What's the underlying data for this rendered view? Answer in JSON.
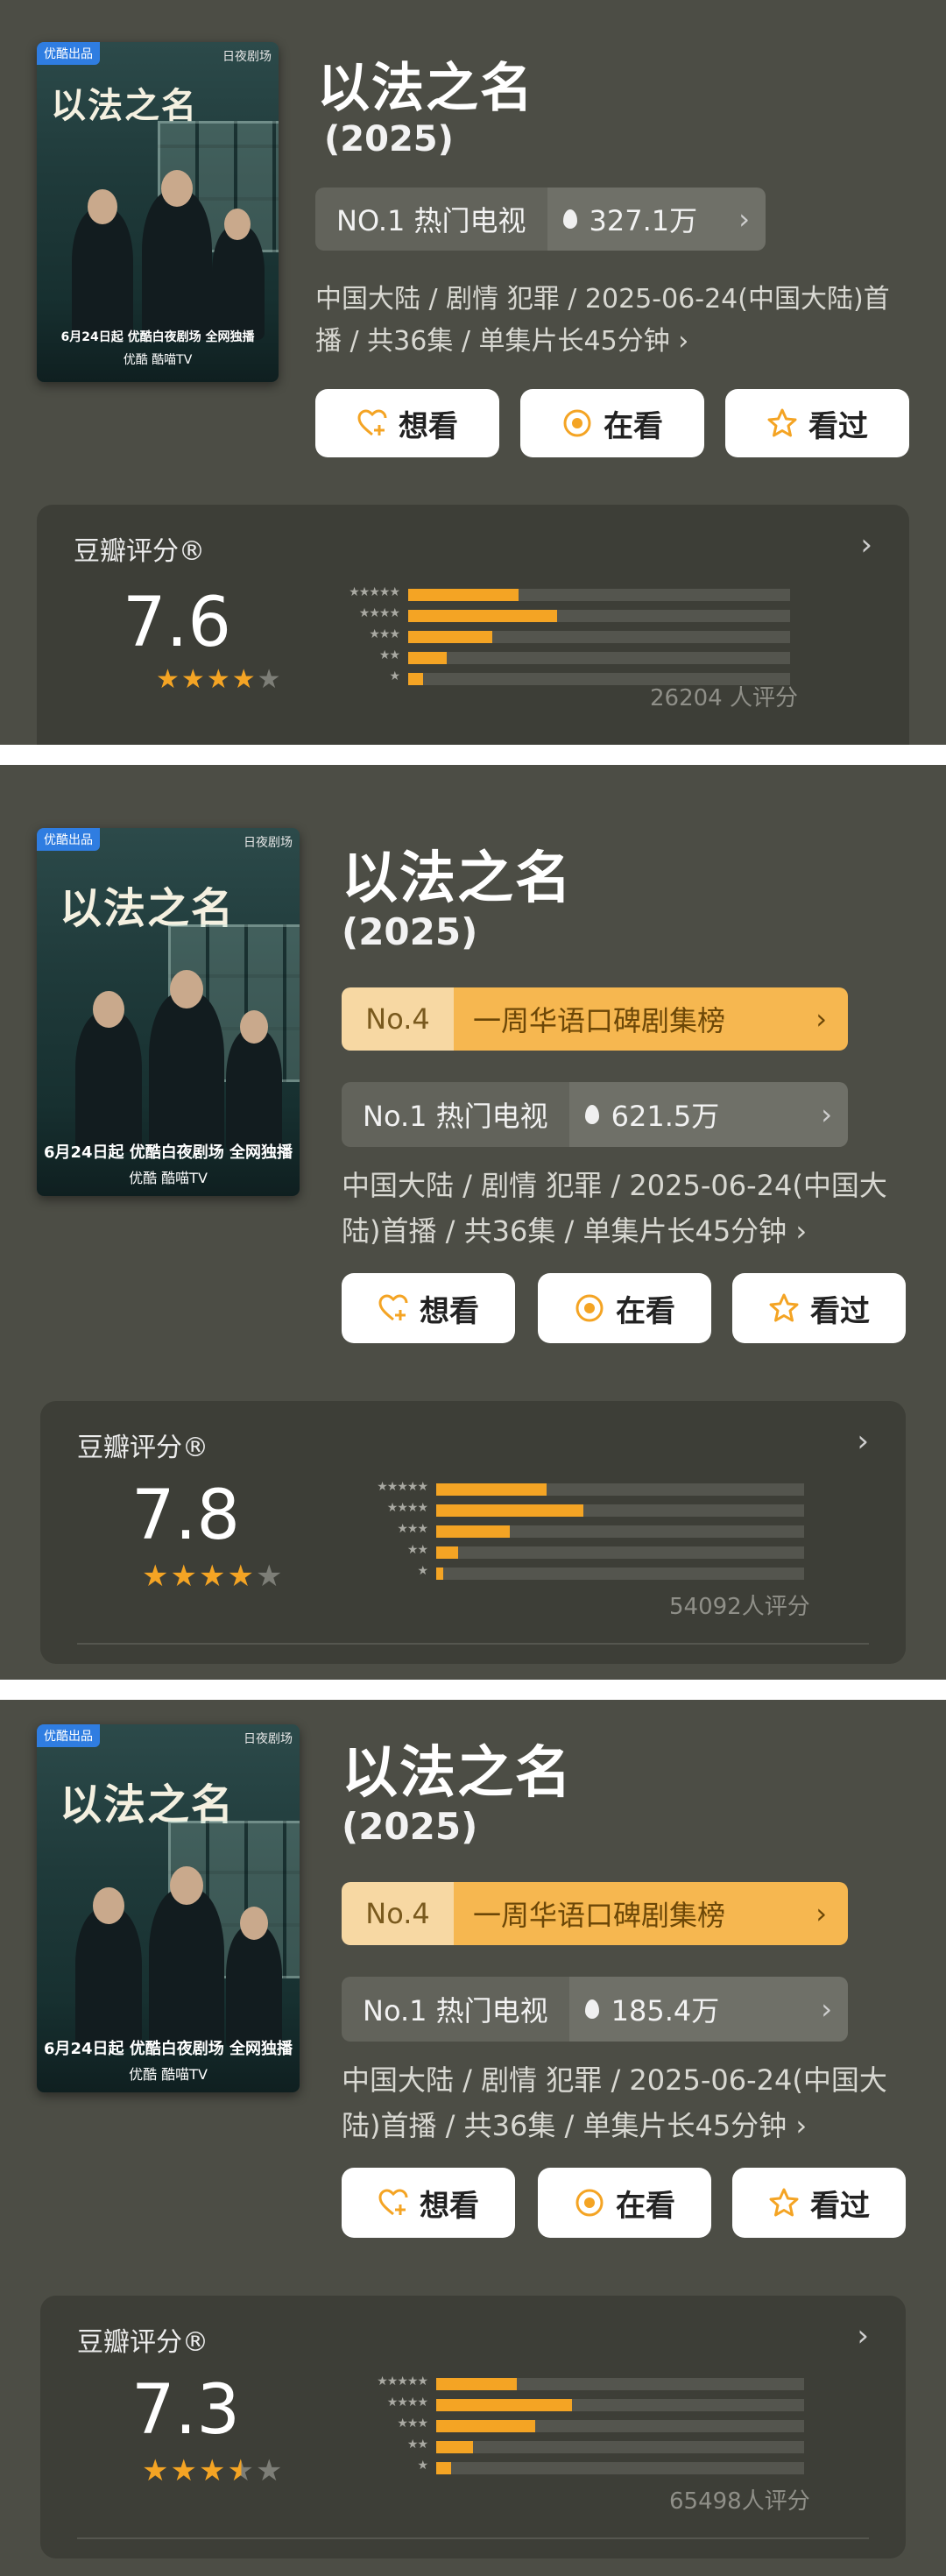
{
  "panels": [
    {
      "poster": {
        "badge": "优酷出品",
        "publisher": "日夜剧场",
        "title": "以法之名",
        "dateline": "6月24日起 优酷白夜剧场 全网独播",
        "platforms": "优酷  酷喵TV"
      },
      "title": "以法之名",
      "year": "(2025)",
      "rank": null,
      "hot": {
        "label": "NO.1 热门电视",
        "value": "327.1万",
        "arrow": "›"
      },
      "meta": "中国大陆 / 剧情 犯罪 / 2025-06-24(中国大陆)首播 / 共36集 / 单集片长45分钟 ›",
      "buttons": [
        {
          "label": "想看",
          "icon": "heart-plus-icon"
        },
        {
          "label": "在看",
          "icon": "circle-dot-icon"
        },
        {
          "label": "看过",
          "icon": "star-outline-icon"
        }
      ],
      "rating": {
        "label": "豆瓣评分®",
        "chevron": "›",
        "score": "7.6",
        "stars": 4,
        "count": "26204 人评分",
        "distribution": [
          0.29,
          0.39,
          0.22,
          0.1,
          0.04
        ]
      }
    },
    {
      "poster": {
        "badge": "优酷出品",
        "publisher": "日夜剧场",
        "title": "以法之名",
        "dateline": "6月24日起 优酷白夜剧场 全网独播",
        "platforms": "优酷  酷喵TV"
      },
      "title": "以法之名",
      "year": "(2025)",
      "rank": {
        "no": "No.4",
        "name": "一周华语口碑剧集榜",
        "arrow": "›"
      },
      "hot": {
        "label": "No.1 热门电视",
        "value": "621.5万",
        "arrow": "›"
      },
      "meta": "中国大陆 / 剧情 犯罪 / 2025-06-24(中国大陆)首播 / 共36集 / 单集片长45分钟 ›",
      "buttons": [
        {
          "label": "想看",
          "icon": "heart-plus-icon"
        },
        {
          "label": "在看",
          "icon": "circle-dot-icon"
        },
        {
          "label": "看过",
          "icon": "star-outline-icon"
        }
      ],
      "rating": {
        "label": "豆瓣评分®",
        "chevron": "›",
        "score": "7.8",
        "stars": 4,
        "count": "54092人评分",
        "distribution": [
          0.3,
          0.4,
          0.2,
          0.06,
          0.02
        ]
      }
    },
    {
      "poster": {
        "badge": "优酷出品",
        "publisher": "日夜剧场",
        "title": "以法之名",
        "dateline": "6月24日起 优酷白夜剧场 全网独播",
        "platforms": "优酷  酷喵TV"
      },
      "title": "以法之名",
      "year": "(2025)",
      "rank": {
        "no": "No.4",
        "name": "一周华语口碑剧集榜",
        "arrow": "›"
      },
      "hot": {
        "label": "No.1 热门电视",
        "value": "185.4万",
        "arrow": "›"
      },
      "meta": "中国大陆 / 剧情 犯罪 / 2025-06-24(中国大陆)首播 / 共36集 / 单集片长45分钟 ›",
      "buttons": [
        {
          "label": "想看",
          "icon": "heart-plus-icon"
        },
        {
          "label": "在看",
          "icon": "circle-dot-icon"
        },
        {
          "label": "看过",
          "icon": "star-outline-icon"
        }
      ],
      "rating": {
        "label": "豆瓣评分®",
        "chevron": "›",
        "score": "7.3",
        "stars": 3.5,
        "count": "65498人评分",
        "distribution": [
          0.22,
          0.37,
          0.27,
          0.1,
          0.04
        ]
      }
    }
  ],
  "colors": {
    "background": "#4c4d45",
    "card": "#3d3e37",
    "bar": "#f4a424",
    "rankLight": "#f7d8a3",
    "rankDark": "#f6b750"
  }
}
